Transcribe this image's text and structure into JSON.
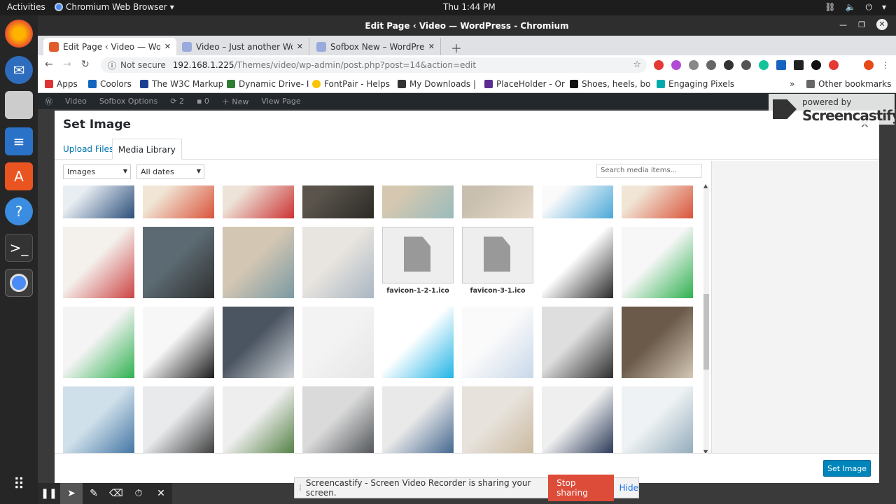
{
  "os": {
    "activities": "Activities",
    "app_menu": "Chromium Web Browser",
    "clock": "Thu  1:44 PM"
  },
  "window": {
    "title": "Edit Page ‹ Video — WordPress - Chromium"
  },
  "tabs": [
    {
      "label": "Edit Page ‹ Video — WordPress",
      "color": "#e05d2c"
    },
    {
      "label": "Video – Just another WordPress",
      "color": "#9ad"
    },
    {
      "label": "Sofbox New – WordPress",
      "color": "#9ad"
    }
  ],
  "omnibox": {
    "security": "Not secure",
    "host": "192.168.1.225",
    "path": "/Themes/video/wp-admin/post.php?post=14&action=edit"
  },
  "bookmarks": [
    {
      "label": "Apps",
      "color": "#d33"
    },
    {
      "label": "Coolors",
      "color": "#1565c0"
    },
    {
      "label": "The W3C Markup",
      "color": "#1a3d8f"
    },
    {
      "label": "Dynamic Drive- I",
      "color": "#2e7d32"
    },
    {
      "label": "FontPair - Helps",
      "color": "#f9c400"
    },
    {
      "label": "My Downloads |",
      "color": "#333"
    },
    {
      "label": "PlaceHolder - Or",
      "color": "#5c2d91"
    },
    {
      "label": "Shoes, heels, bo",
      "color": "#111"
    },
    {
      "label": "Engaging Pixels",
      "color": "#0aa"
    }
  ],
  "other_bookmarks": "Other bookmarks",
  "wp_admin_bar": [
    "Video",
    "Sofbox Options",
    "2",
    "0",
    "New",
    "View Page"
  ],
  "modal": {
    "title": "Set Image",
    "tab_upload": "Upload Files",
    "tab_library": "Media Library",
    "filter_type": "Images",
    "filter_date": "All dates",
    "search_placeholder": "Search media items...",
    "set_button": "Set Image"
  },
  "media_items": [
    {
      "kind": "photo",
      "colors": [
        "#e9eef3",
        "#2b4e7a"
      ]
    },
    {
      "kind": "photo",
      "colors": [
        "#f1e6d6",
        "#d9543b"
      ]
    },
    {
      "kind": "photo",
      "colors": [
        "#ede3d8",
        "#c33"
      ]
    },
    {
      "kind": "photo",
      "colors": [
        "#5a544c",
        "#2c2a26"
      ]
    },
    {
      "kind": "photo",
      "colors": [
        "#d6c8b0",
        "#9bb"
      ]
    },
    {
      "kind": "photo",
      "colors": [
        "#c9bfae",
        "#e8dccb"
      ]
    },
    {
      "kind": "photo",
      "colors": [
        "#fafafa",
        "#4aa8d8"
      ]
    },
    {
      "kind": "photo",
      "colors": [
        "#f1e6d6",
        "#d9543b"
      ]
    },
    {
      "kind": "photo",
      "colors": [
        "#f4f0ec",
        "#c44"
      ]
    },
    {
      "kind": "photo",
      "colors": [
        "#5c6b73",
        "#2f2f2f"
      ]
    },
    {
      "kind": "photo",
      "colors": [
        "#d3c6b2",
        "#7a9aa3"
      ]
    },
    {
      "kind": "photo",
      "colors": [
        "#e8e4df",
        "#a9b6c2"
      ]
    },
    {
      "kind": "file",
      "name": "favicon-1-2-1.ico"
    },
    {
      "kind": "file",
      "name": "favicon-3-1.ico"
    },
    {
      "kind": "photo",
      "colors": [
        "#ffffff",
        "#2a2a2a"
      ]
    },
    {
      "kind": "photo",
      "colors": [
        "#f7f7f7",
        "#2fb150"
      ]
    },
    {
      "kind": "photo",
      "colors": [
        "#f4f4f4",
        "#2fb150"
      ]
    },
    {
      "kind": "photo",
      "colors": [
        "#f7f7f7",
        "#1c1c1c"
      ]
    },
    {
      "kind": "photo",
      "colors": [
        "#4b5562",
        "#cfd4d8"
      ]
    },
    {
      "kind": "photo",
      "colors": [
        "#f3f3f3",
        "#e6e6e6"
      ]
    },
    {
      "kind": "photo",
      "colors": [
        "#ffffff",
        "#22b5e6"
      ]
    },
    {
      "kind": "photo",
      "colors": [
        "#fafafa",
        "#c8d8ea"
      ]
    },
    {
      "kind": "photo",
      "colors": [
        "#dedede",
        "#2e2e2e"
      ]
    },
    {
      "kind": "photo",
      "colors": [
        "#6b5a4a",
        "#d4c7b5"
      ]
    },
    {
      "kind": "photo",
      "colors": [
        "#cfe0ea",
        "#3b6fa0"
      ]
    },
    {
      "kind": "photo",
      "colors": [
        "#e8eaec",
        "#333"
      ]
    },
    {
      "kind": "photo",
      "colors": [
        "#eeeeee",
        "#4b7a3a"
      ]
    },
    {
      "kind": "photo",
      "colors": [
        "#dadada",
        "#4a4e52"
      ]
    },
    {
      "kind": "photo",
      "colors": [
        "#e9e9e9",
        "#3a5f8a"
      ]
    },
    {
      "kind": "photo",
      "colors": [
        "#e7e2dc",
        "#c9b79c"
      ]
    },
    {
      "kind": "photo",
      "colors": [
        "#efefef",
        "#1f2f4f"
      ]
    },
    {
      "kind": "photo",
      "colors": [
        "#eef2f4",
        "#8fa8b8"
      ]
    }
  ],
  "screencastify": {
    "powered_by": "powered by",
    "brand": "Screencastify"
  },
  "share_bar": {
    "message": "Screencastify - Screen Video Recorder is sharing your screen.",
    "stop": "Stop sharing",
    "hide": "Hide"
  }
}
